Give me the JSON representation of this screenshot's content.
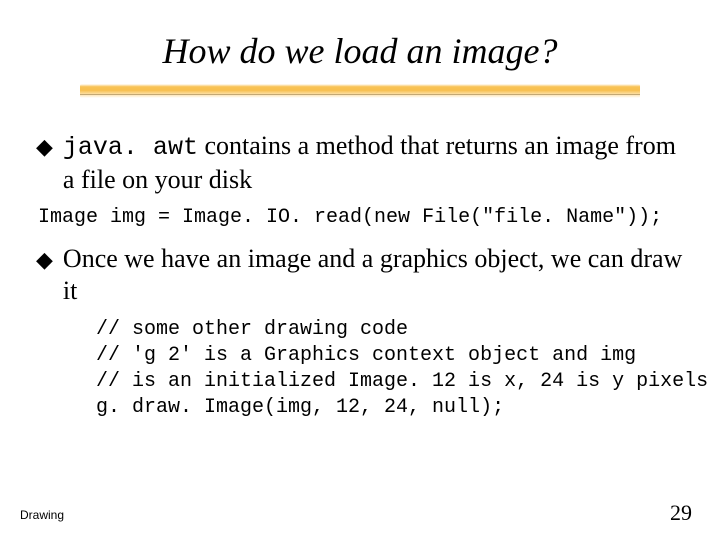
{
  "slide": {
    "title": "How do we load an image?",
    "bullet1_prefix_code": "java. awt",
    "bullet1_rest": " contains a method that returns an image from a file on your disk",
    "code_line1": "Image img = Image. IO. read(new File(\"file. Name\"));",
    "bullet2": "Once we have an image and a graphics object, we can draw it",
    "code_block": "// some other drawing code\n// 'g 2' is a Graphics context object and img\n// is an initialized Image. 12 is x, 24 is y pixels\ng. draw. Image(img, 12, 24, null);",
    "footer_left": "Drawing",
    "footer_right": "29",
    "bullet_symbol": "◆"
  }
}
